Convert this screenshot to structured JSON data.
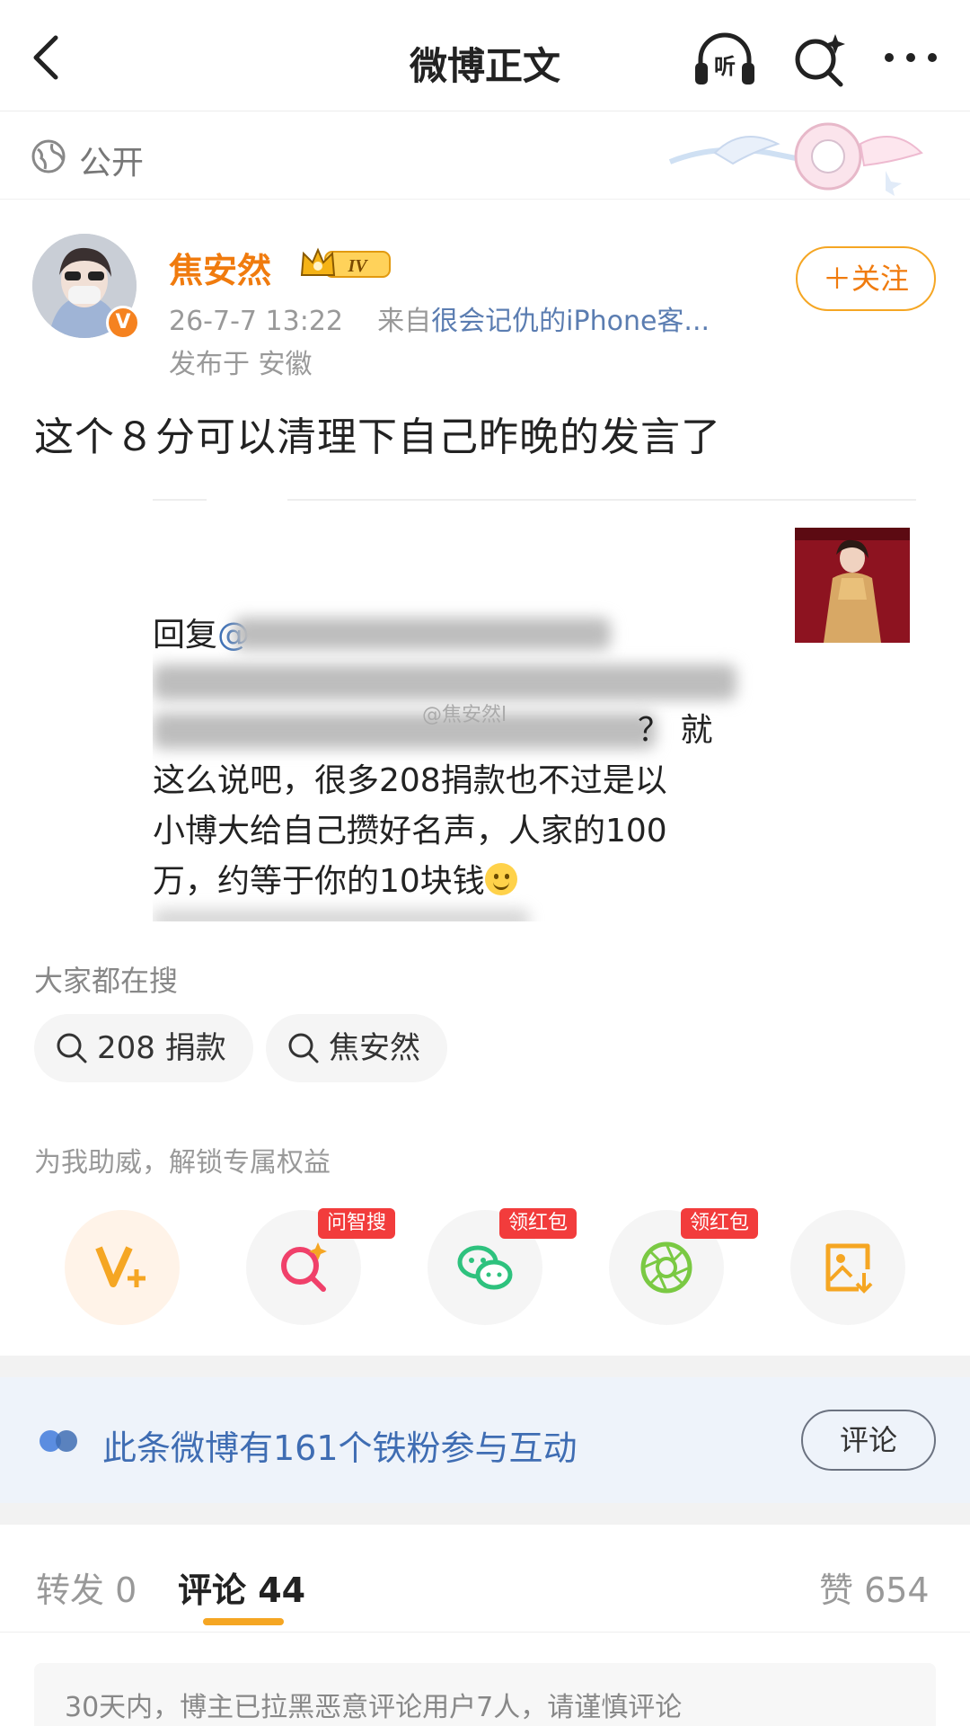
{
  "header": {
    "title": "微博正文",
    "listen_icon_text": "听"
  },
  "visibility": {
    "label": "公开"
  },
  "author": {
    "name": "焦安然",
    "level": "IV",
    "verified_mark": "V",
    "time": "26-7-7 13:22",
    "source_prefix": "来自",
    "source": "很会记仇的iPhone客...",
    "location": "发布于 安徽",
    "follow_label": "＋关注"
  },
  "post": {
    "text": "这个８分可以清理下自己昨晚的发言了",
    "embed": {
      "reply_prefix": "回复",
      "mention": "@",
      "watermark": "@焦安然l",
      "line3_tail": "？ 就",
      "line4": "这么说吧，很多208捐款也不过是以",
      "line5": "小博大给自己攒好名声，人家的100",
      "line6": "万，约等于你的10块钱"
    }
  },
  "trending": {
    "label": "大家都在搜",
    "chips": [
      "208 捐款",
      "焦安然"
    ]
  },
  "unlock": {
    "label": "为我助威，解锁专属权益",
    "tools": [
      {
        "icon": "v-plus-icon",
        "tag": ""
      },
      {
        "icon": "ai-search-icon",
        "tag": "问智搜"
      },
      {
        "icon": "wechat-icon",
        "tag": "领红包"
      },
      {
        "icon": "moments-icon",
        "tag": "领红包"
      },
      {
        "icon": "save-image-icon",
        "tag": ""
      }
    ]
  },
  "fans": {
    "text": "此条微博有161个铁粉参与互动",
    "button": "评论"
  },
  "tabs": {
    "repost": "转发 0",
    "comments": "评论 44",
    "likes": "赞 654"
  },
  "notice": "30天内，博主已拉黑恶意评论用户7人，请谨慎评论"
}
